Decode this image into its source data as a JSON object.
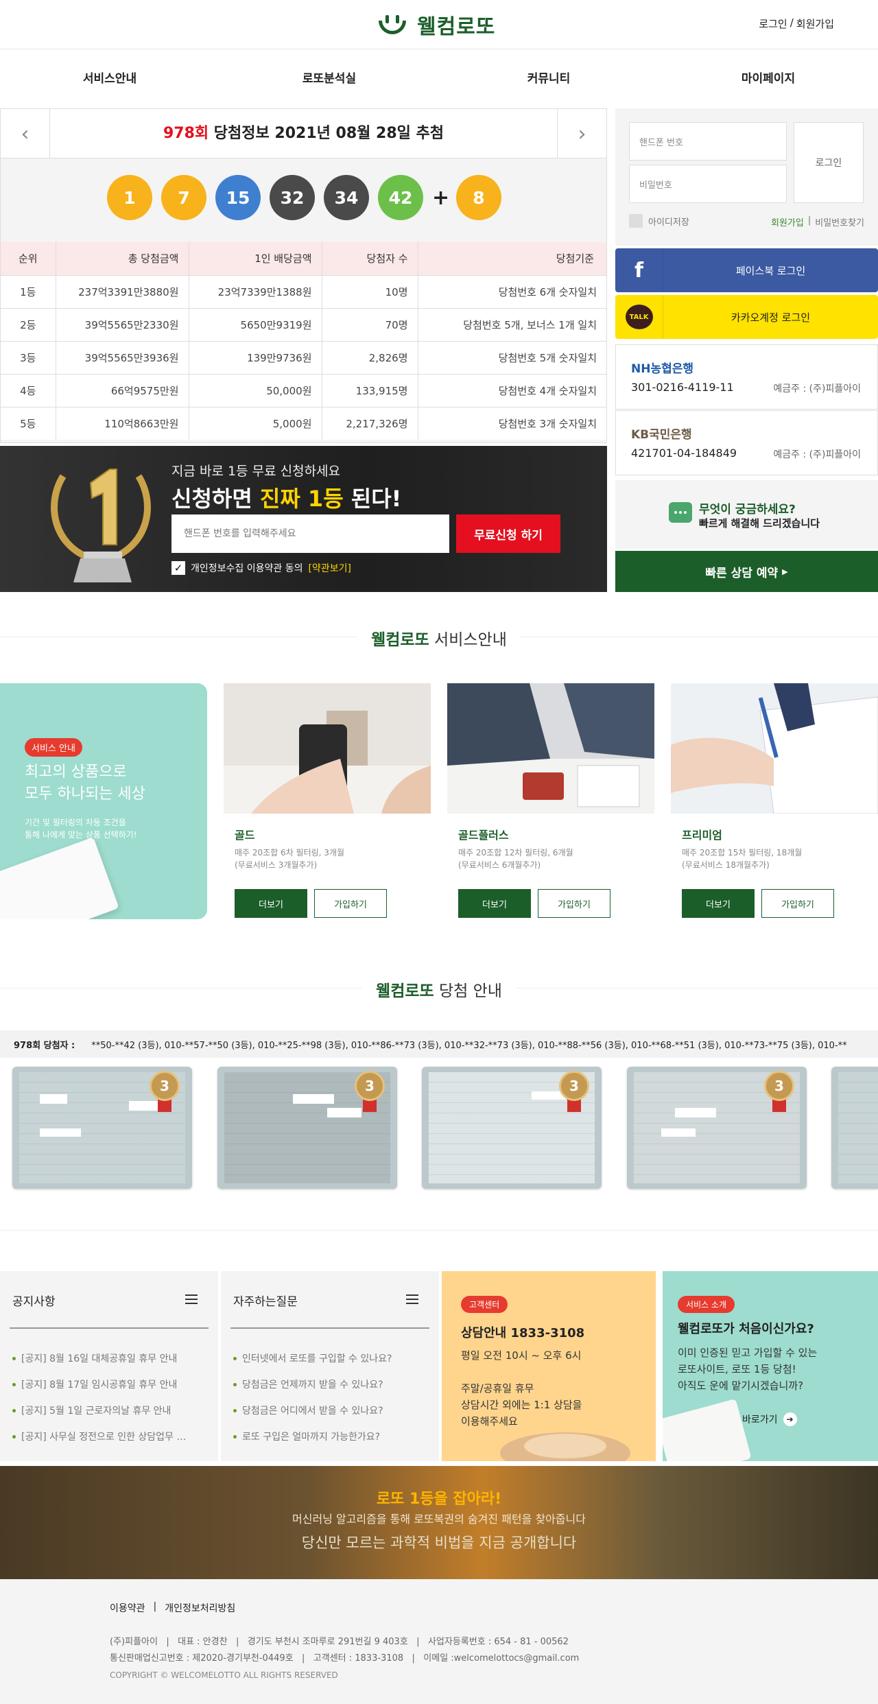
{
  "header": {
    "brand": "웰컴로또",
    "login": "로그인",
    "sep": "/",
    "signup": "회원가입"
  },
  "nav": [
    "서비스안내",
    "로또분석실",
    "커뮤니티",
    "마이페이지"
  ],
  "draw": {
    "round": "978회",
    "title_rest": " 당첨정보 2021년 08월 28일 추첨",
    "balls": [
      {
        "n": "1",
        "color": "#f8b21c"
      },
      {
        "n": "7",
        "color": "#f8b21c"
      },
      {
        "n": "15",
        "color": "#3f7fd0"
      },
      {
        "n": "32",
        "color": "#4a4a4a"
      },
      {
        "n": "34",
        "color": "#4a4a4a"
      },
      {
        "n": "42",
        "color": "#6cc04a"
      }
    ],
    "plus": "+",
    "bonus": {
      "n": "8",
      "color": "#f8b21c"
    },
    "table": {
      "headers": [
        "순위",
        "총 당첨금액",
        "1인 배당금액",
        "당첨자 수",
        "당첨기준"
      ],
      "rows": [
        [
          "1등",
          "237억3391만3880원",
          "23억7339만1388원",
          "10명",
          "당첨번호 6개 숫자일치"
        ],
        [
          "2등",
          "39억5565만2330원",
          "5650만9319원",
          "70명",
          "당첨번호 5개, 보너스 1개 일치"
        ],
        [
          "3등",
          "39억5565만3936원",
          "139만9736원",
          "2,826명",
          "당첨번호 5개 숫자일치"
        ],
        [
          "4등",
          "66억9575만원",
          "50,000원",
          "133,915명",
          "당첨번호 4개 숫자일치"
        ],
        [
          "5등",
          "110억8663만원",
          "5,000원",
          "2,217,326명",
          "당첨번호 3개 숫자일치"
        ]
      ]
    }
  },
  "apply": {
    "sub": "지금 바로 1등 무료 신청하세요",
    "title_a": "신청하면 ",
    "title_b": "진짜 1등",
    "title_c": " 된다!",
    "placeholder": "핸드폰 번호를 입력해주세요",
    "button": "무료신청 하기",
    "agree": "개인정보수집 이용약관 동의",
    "agree_link": "[약관보기]"
  },
  "login": {
    "phone_placeholder": "핸드폰 번호",
    "pw_placeholder": "비밀번호",
    "button": "로그인",
    "save_id": "아이디저장",
    "join": "회원가입",
    "divider": "|",
    "find_pw": "비밀번호찾기"
  },
  "sns": {
    "facebook": "페이스북 로그인",
    "kakao": "카카오계정 로그인",
    "kakao_icon_text": "TALK"
  },
  "banks": [
    {
      "name": "NH농협은행",
      "account": "301-0216-4119-11",
      "holder": "예금주 : (주)피플아이"
    },
    {
      "name": "KB국민은행",
      "account": "421701-04-184849",
      "holder": "예금주 : (주)피플아이"
    }
  ],
  "qna": {
    "line1": "무엇이 궁금하세요?",
    "line2": "빠르게 해결해 드리겠습니다",
    "button": "빠른 상담 예약"
  },
  "service": {
    "title_brand": "웰컴로또",
    "title_rest": " 서비스안내",
    "intro": {
      "badge": "서비스 안내",
      "head1": "최고의 상품으로",
      "head2": "모두 하나되는 세상",
      "desc1": "기간 및 필터링의 차등 조건을",
      "desc2": "통해 나에게 맞는 상품 선택하기!"
    },
    "cards": [
      {
        "name": "골드",
        "desc1": "매주 20조합 6차 필터링, 3개월",
        "desc2": "(무료서비스 3개월추가)",
        "more": "더보기",
        "join": "가입하기"
      },
      {
        "name": "골드플러스",
        "desc1": "매주 20조합 12차 필터링, 6개월",
        "desc2": "(무료서비스 6개월추가)",
        "more": "더보기",
        "join": "가입하기"
      },
      {
        "name": "프리미엄",
        "desc1": "매주 20조합 15차 필터링, 18개월",
        "desc2": "(무료서비스 18개월추가)",
        "more": "더보기",
        "join": "가입하기"
      }
    ]
  },
  "winners": {
    "title_brand": "웰컴로또",
    "title_rest": " 당첨 안내",
    "ticker_label": "978회 당첨자 :",
    "ticker_text": "**50-**42 (3등), 010-**57-**50 (3등), 010-**25-**98 (3등), 010-**86-**73 (3등), 010-**32-**73 (3등), 010-**88-**56 (3등), 010-**68-**51 (3등), 010-**73-**75 (3등), 010-**",
    "medal": "3"
  },
  "notice": {
    "title": "공지사항",
    "items": [
      "[공지] 8월 16일 대체공휴일 휴무 안내",
      "[공지] 8월 17일 임시공휴일 휴무 안내",
      "[공지] 5월 1일 근로자의날 휴무 안내",
      "[공지] 사무실 정전으로 인한 상담업무 …"
    ]
  },
  "faq": {
    "title": "자주하는질문",
    "items": [
      "인터넷에서 로또를 구입할 수 있나요?",
      "당첨금은 언제까지 받을 수 있나요?",
      "당첨금은 어디에서 받을 수 있나요?",
      "로또 구입은 얼마까지 가능한가요?"
    ]
  },
  "cs": {
    "badge": "고객센터",
    "title": "상담안내 1833-3108",
    "line1": "평일 오전 10시 ~ 오후 6시",
    "line2": "주말/공휴일 휴무",
    "line3": "상담시간 외에는 1:1 상담을",
    "line4": "이용해주세요"
  },
  "intro_box": {
    "badge": "서비스 소개",
    "title": "웰컴로또가 처음이신가요?",
    "line1": "이미 인증된 믿고 가입할 수 있는",
    "line2": "로또사이트, 로또 1등 당첨!",
    "line3": "아직도 운에 맡기시겠습니까?",
    "go": "바로가기"
  },
  "promo": {
    "t1": "로또 1등을 잡아라!",
    "t2": "머신러닝 알고리즘을 통해 로또복권의 숨겨진 패턴을 찾아줍니다",
    "t3": "당신만 모르는 과학적 비법을 지금 공개합니다"
  },
  "footer": {
    "terms": "이용약관",
    "sep": "|",
    "privacy": "개인정보처리방침",
    "line1": "(주)피플아이   |   대표 : 안경찬   |   경기도 부천시 조마루로 291번길 9 403호   |   사업자등록번호 : 654 - 81 - 00562",
    "line2": "통신판매업신고번호 : 제2020-경기부천-0449호   |   고객센터 : 1833-3108   |   이메일 :welcomelottocs@gmail.com",
    "line3": "COPYRIGHT © WELCOMELOTTO ALL RIGHTS RESERVED"
  },
  "colors": {
    "brand_green": "#1c5e2a",
    "accent_red": "#e4101f",
    "accent_yellow": "#ffd400",
    "mint": "#9ddcce",
    "peach": "#ffd58e"
  }
}
